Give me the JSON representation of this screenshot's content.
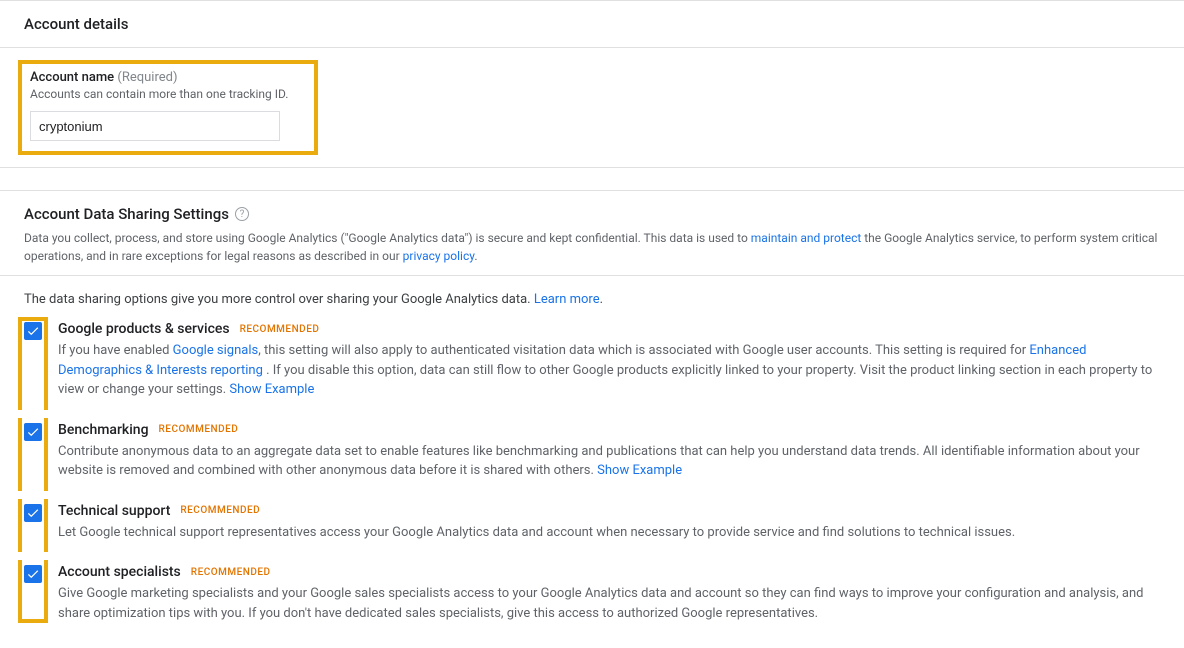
{
  "account_details": {
    "header": "Account details",
    "name_label": "Account name",
    "name_required": "(Required)",
    "name_help": "Accounts can contain more than one tracking ID.",
    "name_value": "cryptonium"
  },
  "data_sharing": {
    "title": "Account Data Sharing Settings",
    "desc_pre": "Data you collect, process, and store using Google Analytics (\"Google Analytics data\") is secure and kept confidential. This data is used to ",
    "desc_link1": "maintain and protect",
    "desc_mid": " the Google Analytics service, to perform system critical operations, and in rare exceptions for legal reasons as described in our ",
    "desc_link2": "privacy policy",
    "desc_post": ".",
    "intro_pre": "The data sharing options give you more control over sharing your Google Analytics data. ",
    "intro_link": "Learn more",
    "intro_post": ".",
    "recommended": "RECOMMENDED",
    "options": [
      {
        "title": "Google products & services",
        "desc_pre": "If you have enabled ",
        "link1": "Google signals",
        "desc_mid1": ", this setting will also apply to authenticated visitation data which is associated with Google user accounts. This setting is required for ",
        "link2": "Enhanced Demographics & Interests reporting ",
        "desc_mid2": ". If you disable this option, data can still flow to other Google products explicitly linked to your property. Visit the product linking section in each property to view or change your settings. ",
        "link3": "Show Example"
      },
      {
        "title": "Benchmarking",
        "desc_pre": "Contribute anonymous data to an aggregate data set to enable features like benchmarking and publications that can help you understand data trends. All identifiable information about your website is removed and combined with other anonymous data before it is shared with others. ",
        "link1": "Show Example"
      },
      {
        "title": "Technical support",
        "desc": "Let Google technical support representatives access your Google Analytics data and account when necessary to provide service and find solutions to technical issues."
      },
      {
        "title": "Account specialists",
        "desc": "Give Google marketing specialists and your Google sales specialists access to your Google Analytics data and account so they can find ways to improve your configuration and analysis, and share optimization tips with you. If you don't have dedicated sales specialists, give this access to authorized Google representatives."
      }
    ]
  }
}
